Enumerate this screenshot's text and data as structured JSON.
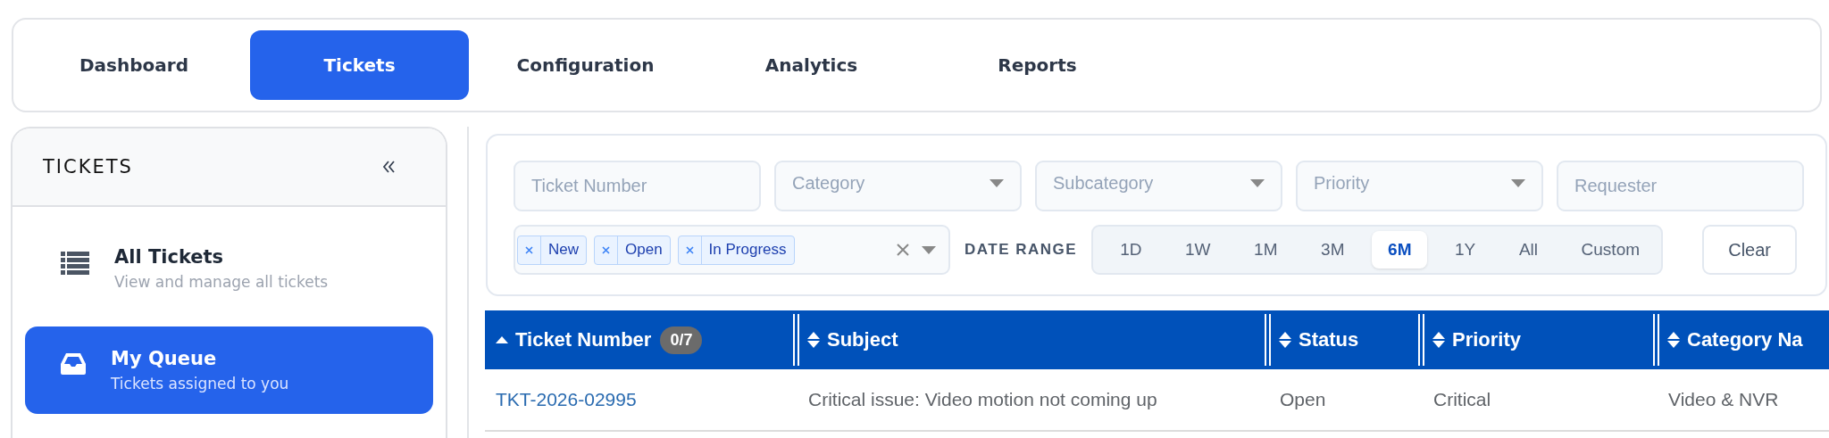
{
  "nav": {
    "tabs": [
      {
        "label": "Dashboard",
        "selected": false
      },
      {
        "label": "Tickets",
        "selected": true
      },
      {
        "label": "Configuration",
        "selected": false
      },
      {
        "label": "Analytics",
        "selected": false
      },
      {
        "label": "Reports",
        "selected": false
      }
    ]
  },
  "sidebar": {
    "title": "TICKETS",
    "items": [
      {
        "kind": "list",
        "title": "All Tickets",
        "subtitle": "View and manage all tickets",
        "selected": false
      },
      {
        "kind": "inbox",
        "title": "My Queue",
        "subtitle": "Tickets assigned to you",
        "selected": true
      }
    ]
  },
  "filters": {
    "fields": [
      {
        "kind": "text",
        "placeholder": "Ticket Number"
      },
      {
        "kind": "select",
        "placeholder": "Category"
      },
      {
        "kind": "select",
        "placeholder": "Subcategory"
      },
      {
        "kind": "select",
        "placeholder": "Priority"
      },
      {
        "kind": "text",
        "placeholder": "Requester"
      }
    ],
    "status_tags": [
      "New",
      "Open",
      "In Progress"
    ],
    "date_range": {
      "label": "DATE RANGE",
      "options": [
        {
          "label": "1D",
          "selected": false
        },
        {
          "label": "1W",
          "selected": false
        },
        {
          "label": "1M",
          "selected": false
        },
        {
          "label": "3M",
          "selected": false
        },
        {
          "label": "6M",
          "selected": true
        },
        {
          "label": "1Y",
          "selected": false
        },
        {
          "label": "All",
          "selected": false
        },
        {
          "label": "Custom",
          "selected": false
        }
      ]
    },
    "clear_button": "Clear"
  },
  "table": {
    "columns": [
      {
        "label": "Ticket Number",
        "sorted": true,
        "badge": "0/7"
      },
      {
        "label": "Subject",
        "sorted": false
      },
      {
        "label": "Status",
        "sorted": false
      },
      {
        "label": "Priority",
        "sorted": false
      },
      {
        "label": "Category Na",
        "sorted": false
      }
    ],
    "rows": [
      {
        "cells": [
          "TKT-2026-02995",
          "Critical issue: Video motion not coming up",
          "Open",
          "Critical",
          "Video & NVR"
        ]
      }
    ]
  }
}
